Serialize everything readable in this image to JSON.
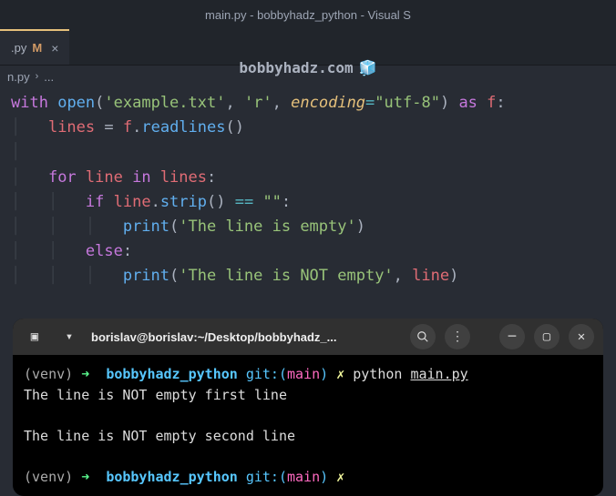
{
  "window": {
    "title": "main.py - bobbyhadz_python - Visual S"
  },
  "tab": {
    "name": ".py",
    "modified": "M",
    "close": "×"
  },
  "watermark": {
    "text": "bobbyhadz.com",
    "icon": "🧊"
  },
  "breadcrumb": {
    "file": "n.py",
    "chev": "›",
    "more": "..."
  },
  "code": {
    "l1_with": "with",
    "l1_open": "open",
    "l1_p1": "(",
    "l1_file": "'example.txt'",
    "l1_c1": ", ",
    "l1_mode": "'r'",
    "l1_c2": ", ",
    "l1_enc_k": "encoding",
    "l1_eq": "=",
    "l1_enc_v": "\"utf-8\"",
    "l1_p2": ")",
    "l1_as": " as",
    "l1_f": " f",
    "l1_colon": ":",
    "l2_lines": "lines",
    "l2_eq": " = ",
    "l2_f": "f",
    "l2_dot": ".",
    "l2_rl": "readlines",
    "l2_par": "()",
    "l4_for": "for",
    "l4_line": " line",
    "l4_in": " in",
    "l4_lines": " lines",
    "l4_colon": ":",
    "l5_if": "if",
    "l5_line": " line",
    "l5_dot": ".",
    "l5_strip": "strip",
    "l5_par": "()",
    "l5_eq": " == ",
    "l5_empty": "\"\"",
    "l5_colon": ":",
    "l6_print": "print",
    "l6_p1": "(",
    "l6_str": "'The line is empty'",
    "l6_p2": ")",
    "l7_else": "else",
    "l7_colon": ":",
    "l8_print": "print",
    "l8_p1": "(",
    "l8_str": "'The line is NOT empty'",
    "l8_c": ", ",
    "l8_line": "line",
    "l8_p2": ")"
  },
  "terminal": {
    "title": "borislav@borislav:~/Desktop/bobbyhadz_...",
    "venv": "(venv)",
    "arrow": "➜",
    "dir": "bobbyhadz_python",
    "git": "git:(",
    "branch": "main",
    "git_close": ")",
    "star": "✗",
    "cmd_py": "python ",
    "cmd_file": "main.py",
    "out1": "The line is NOT empty first line",
    "out2": "The line is NOT empty second line"
  }
}
